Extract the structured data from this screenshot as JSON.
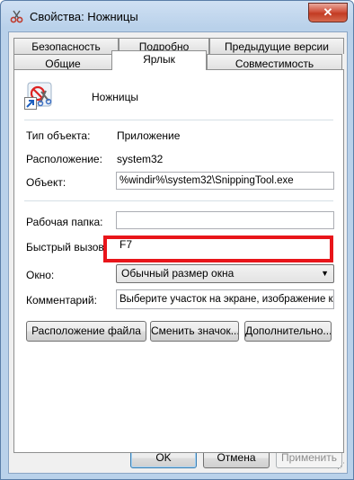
{
  "window": {
    "title": "Свойства: Ножницы",
    "close_label": "✕"
  },
  "tabs_back": [
    "Безопасность",
    "Подробно",
    "Предыдущие версии"
  ],
  "tabs_front": [
    "Общие",
    "Ярлык",
    "Совместимость"
  ],
  "shortcut": {
    "name": "Ножницы",
    "type_label": "Тип объекта:",
    "type_value": "Приложение",
    "location_label": "Расположение:",
    "location_value": "system32",
    "target_label": "Объект:",
    "target_value": "%windir%\\system32\\SnippingTool.exe",
    "startin_label": "Рабочая папка:",
    "startin_value": "",
    "hotkey_label": "Быстрый вызов:",
    "hotkey_value": "F7",
    "run_label": "Окно:",
    "run_value": "Обычный размер окна",
    "comment_label": "Комментарий:",
    "comment_value": "Выберите участок на экране, изображение ко"
  },
  "buttons": {
    "open_location": "Расположение файла",
    "change_icon": "Сменить значок...",
    "advanced": "Дополнительно...",
    "ok": "OK",
    "cancel": "Отмена",
    "apply": "Применить"
  },
  "colors": {
    "highlight": "#e8151a",
    "titlebar": "#b9d1ea"
  }
}
